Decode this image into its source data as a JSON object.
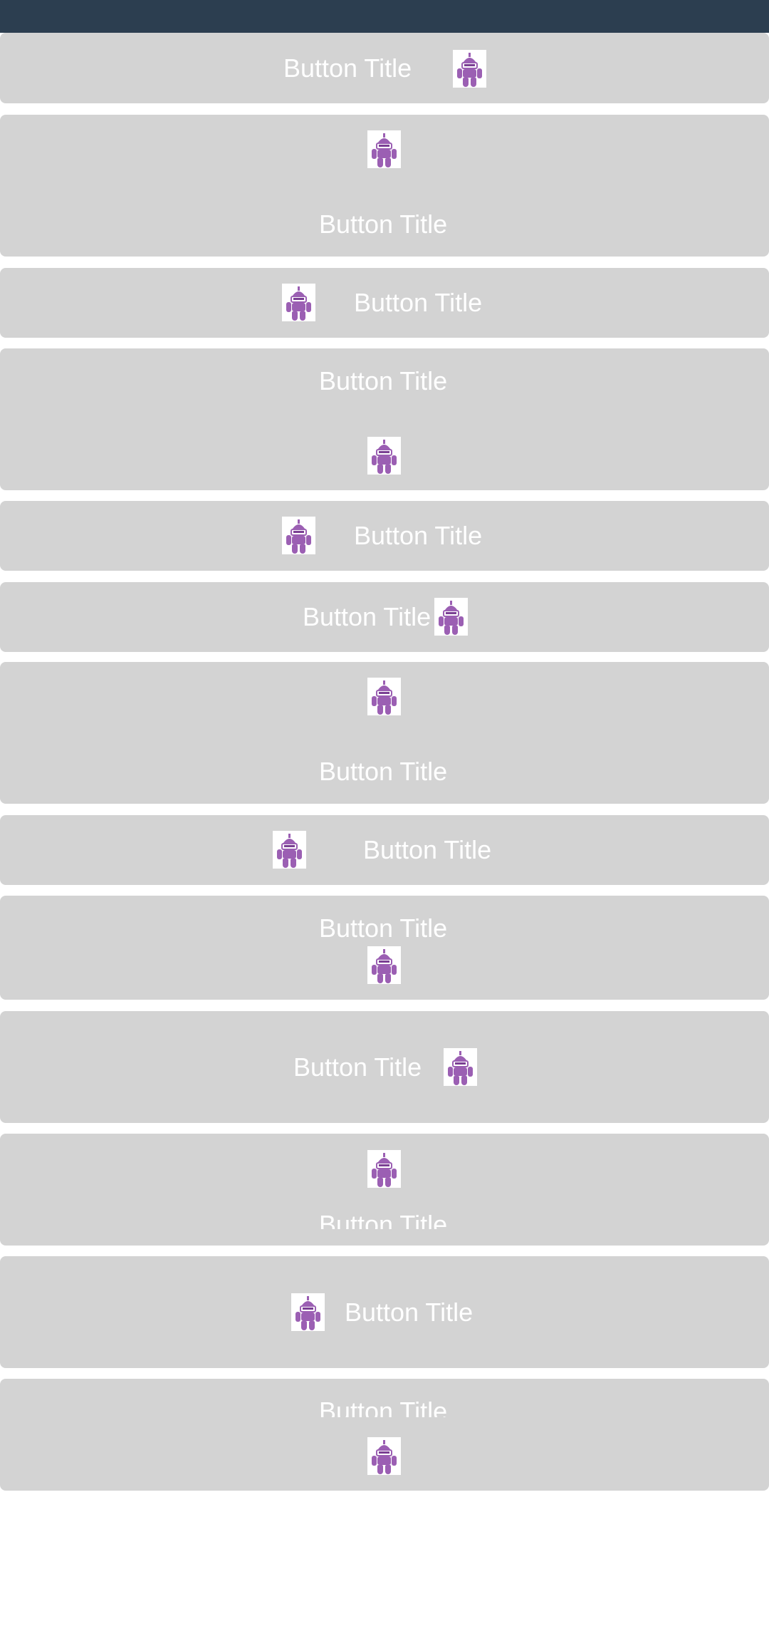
{
  "colors": {
    "statusbar": "#2c3e50",
    "button_bg": "#d3d3d3",
    "button_text": "#ffffff",
    "icon": "#9b5fb3"
  },
  "buttons": [
    {
      "label": "Button Title",
      "icon": "dotnet-bot-icon"
    },
    {
      "label": "Button Title",
      "icon": "dotnet-bot-icon"
    },
    {
      "label": "Button Title",
      "icon": "dotnet-bot-icon"
    },
    {
      "label": "Button Title",
      "icon": "dotnet-bot-icon"
    },
    {
      "label": "Button Title",
      "icon": "dotnet-bot-icon"
    },
    {
      "label": "Button Title",
      "icon": "dotnet-bot-icon"
    },
    {
      "label": "Button Title",
      "icon": "dotnet-bot-icon"
    },
    {
      "label": "Button Title",
      "icon": "dotnet-bot-icon"
    },
    {
      "label": "Button Title",
      "icon": "dotnet-bot-icon"
    },
    {
      "label": "Button Title",
      "icon": "dotnet-bot-icon"
    },
    {
      "label": "Button Title",
      "icon": "dotnet-bot-icon"
    },
    {
      "label": "Button Title",
      "icon": "dotnet-bot-icon"
    },
    {
      "label": "Button Title",
      "icon": "dotnet-bot-icon"
    }
  ]
}
